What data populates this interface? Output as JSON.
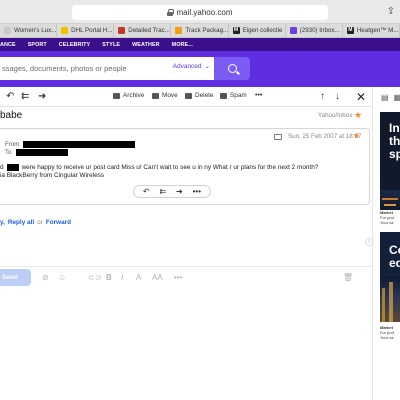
{
  "browser": {
    "url": "mail.yahoo.com",
    "tabs": [
      {
        "label": "Women's Lux...",
        "color": "#c9c9c9",
        "glyph": ""
      },
      {
        "label": "DHL Portal H...",
        "color": "#f2c200",
        "glyph": ""
      },
      {
        "label": "Detailed Trac...",
        "color": "#c0392b",
        "glyph": ""
      },
      {
        "label": "Track Packag...",
        "color": "#f39c12",
        "glyph": ""
      },
      {
        "label": "Eigen collectie",
        "color": "#222222",
        "glyph": "M"
      },
      {
        "label": "(2930) Inbox...",
        "color": "#6c3fe0",
        "glyph": ""
      },
      {
        "label": "Heatgen™ M...",
        "color": "#222222",
        "glyph": "M"
      }
    ]
  },
  "yahoo_nav": [
    "ANCE",
    "SPORT",
    "CELEBRITY",
    "STYLE",
    "WEATHER",
    "MORE..."
  ],
  "search": {
    "placeholder": "ssages, documents, photos or people",
    "advanced": "Advanced"
  },
  "toolbar": {
    "archive": "Archive",
    "move": "Move",
    "delete": "Delete",
    "spam": "Spam",
    "more": "•••"
  },
  "message": {
    "subject": "babe",
    "folder": "Yahoo/Inbox",
    "date": "Sun, 25 Feb 2007 at 18:17",
    "from_label": "From",
    "to_label": "To",
    "body_pre": "d",
    "body_line1": "were happy to receive ur post card Miss u! Can't wait to see u in ny What r ur plans for the next 2 month?",
    "body_line2": "ia BlackBerry from Cingular Wireless"
  },
  "reply": {
    "prefix": "y,",
    "reply_all": "Reply all",
    "or": "or",
    "forward": "Forward"
  },
  "compose": {
    "send": "Send"
  },
  "ads": {
    "ad1_lines": [
      "Inv",
      "the",
      "sp"
    ],
    "ad1_small": [
      "Market",
      "For prot",
      "Your ca"
    ],
    "ad2_lines": [
      "Co",
      "eq"
    ],
    "ad2_small": [
      "Market",
      "For prof",
      "Your ca"
    ]
  },
  "colors": {
    "nav_bg": "#3b0f8c",
    "search_band": "#5f2ee0",
    "search_button": "#7b5cf2",
    "star": "#f08a24",
    "link": "#1d5fd6",
    "send_button": "#bccdf6"
  }
}
